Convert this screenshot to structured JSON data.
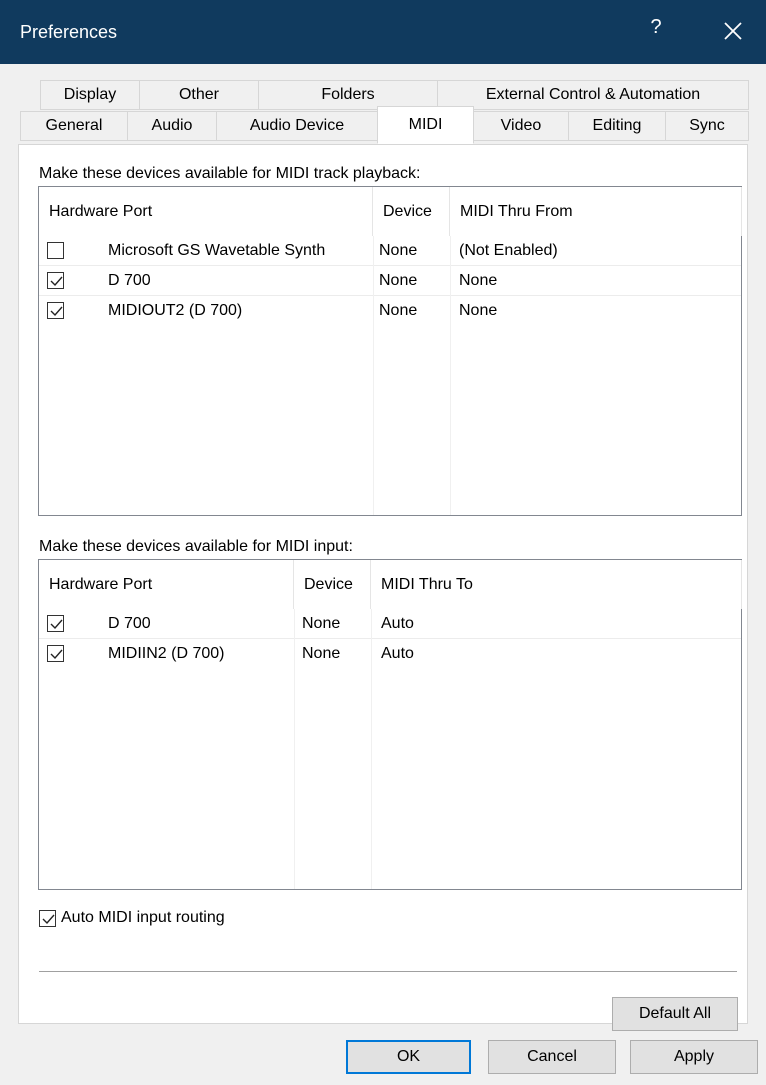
{
  "window": {
    "title": "Preferences",
    "help_glyph": "?",
    "close_glyph": "✕"
  },
  "tabs_row1": [
    "Display",
    "Other",
    "Folders",
    "External Control & Automation"
  ],
  "tabs_row2": [
    "General",
    "Audio",
    "Audio Device",
    "MIDI",
    "Video",
    "Editing",
    "Sync"
  ],
  "active_tab": "MIDI",
  "playback": {
    "caption": "Make these devices available for MIDI track playback:",
    "columns": [
      "Hardware Port",
      "Device",
      "MIDI Thru From"
    ],
    "rows": [
      {
        "checked": false,
        "port": "Microsoft GS Wavetable Synth",
        "device": "None",
        "thru": "(Not Enabled)"
      },
      {
        "checked": true,
        "port": "D 700",
        "device": "None",
        "thru": "None"
      },
      {
        "checked": true,
        "port": "MIDIOUT2 (D 700)",
        "device": "None",
        "thru": "None"
      }
    ]
  },
  "input": {
    "caption": "Make these devices available for MIDI input:",
    "columns": [
      "Hardware Port",
      "Device",
      "MIDI Thru To"
    ],
    "rows": [
      {
        "checked": true,
        "port": "D 700",
        "device": "None",
        "thru": "Auto"
      },
      {
        "checked": true,
        "port": "MIDIIN2 (D 700)",
        "device": "None",
        "thru": "Auto"
      }
    ]
  },
  "auto_routing": {
    "checked": true,
    "label": "Auto MIDI input routing"
  },
  "buttons": {
    "default_all": "Default All",
    "ok": "OK",
    "cancel": "Cancel",
    "apply": "Apply"
  },
  "colors": {
    "titlebar": "#103a5e",
    "focus_border": "#0078d7"
  }
}
